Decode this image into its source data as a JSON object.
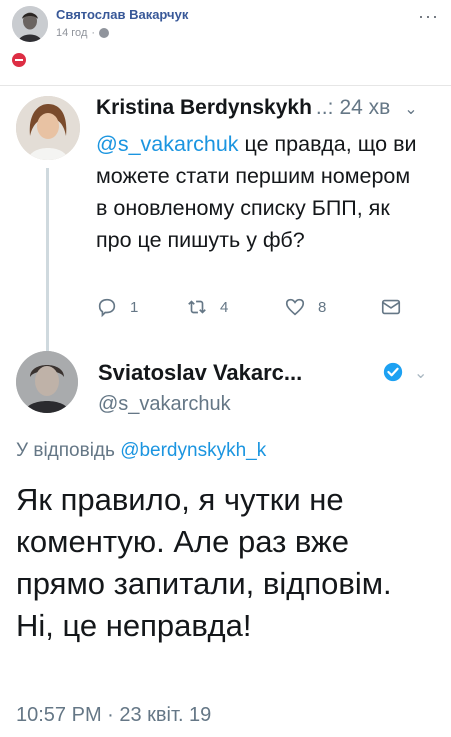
{
  "post": {
    "author": "Святослав Вакарчук",
    "time": "14 год",
    "separator": "·",
    "more": "···"
  },
  "tweet1": {
    "name": "Kristina Berdynskykh",
    "dots": "..:",
    "time": "24 хв",
    "chevron": "⌄",
    "mention": "@s_vakarchuk",
    "text": " це правда, що ви можете стати першим номером в оновленому списку БПП, як про це пишуть у фб?",
    "replies": "1",
    "retweets": "4",
    "likes": "8"
  },
  "tweet2": {
    "name": "Sviatoslav Vakarc...",
    "chevron": "⌄",
    "handle": "@s_vakarchuk",
    "reply_prefix": "У відповідь ",
    "reply_mention": "@berdynskykh_k",
    "text": "Як правило, я чутки не коментую. Але раз вже прямо запитали, відповім. Ні, це неправда!",
    "timestamp": "10:57 PM · 23 квіт. 19"
  },
  "icons": {
    "post_privacy": "globe-icon",
    "emoji": "no-entry-icon",
    "reply": "reply-icon",
    "retweet": "retweet-icon",
    "like": "heart-icon",
    "dm": "envelope-icon",
    "verified": "verified-badge-icon"
  },
  "colors": {
    "fb_name": "#385898",
    "twitter_link": "#1b95e0",
    "muted": "#657786",
    "verified": "#1da1f2",
    "no_entry": "#dd2e44"
  }
}
